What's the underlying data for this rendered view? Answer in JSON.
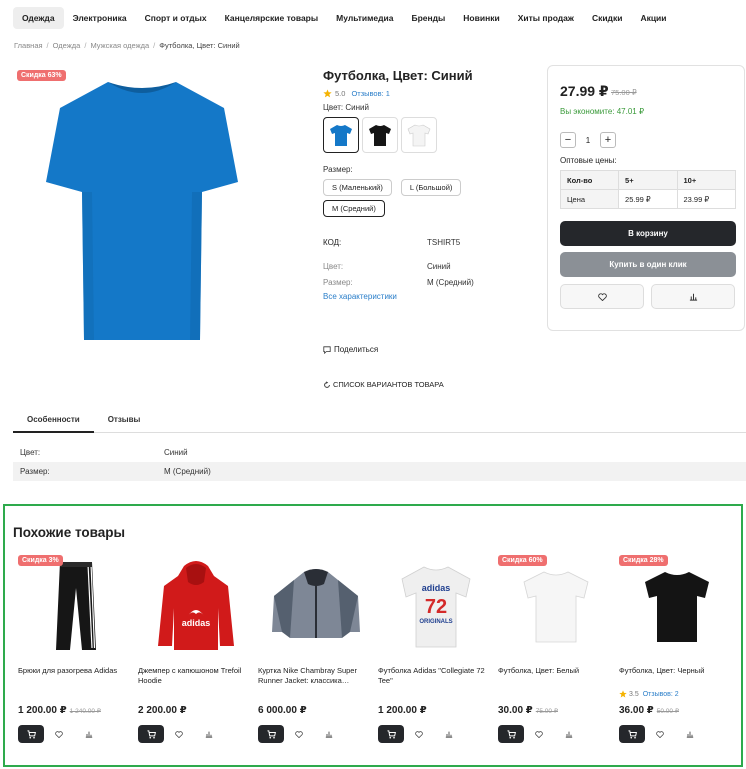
{
  "nav": {
    "items": [
      "Одежда",
      "Электроника",
      "Спорт и отдых",
      "Канцелярские товары",
      "Мультимедиа",
      "Бренды",
      "Новинки",
      "Хиты продаж",
      "Скидки",
      "Акции"
    ]
  },
  "breadcrumb": [
    "Главная",
    "Одежда",
    "Мужская одежда",
    "Футболка, Цвет: Синий"
  ],
  "product": {
    "badge": "Скидка 63%",
    "title": "Футболка, Цвет: Синий",
    "rating": "5.0",
    "reviews": "Отзывов: 1",
    "color_label": "Цвет: Синий",
    "size_label": "Размер:",
    "sizes": [
      "S (Маленький)",
      "L (Большой)",
      "M (Средний)"
    ],
    "selected_size_index": 2,
    "specs": {
      "code_label": "КОД:",
      "code_value": "TSHIRT5",
      "color_label": "Цвет:",
      "color_value": "Синий",
      "size_label": "Размер:",
      "size_value": "M (Средний)"
    },
    "all_specs_link": "Все характеристики",
    "share": "Поделиться",
    "variants": "СПИСОК ВАРИАНТОВ ТОВАРА",
    "colors": {
      "blue": "#1478c8",
      "black": "#151515",
      "white": "#f4f4f4"
    }
  },
  "buybox": {
    "price": "27.99 ₽",
    "old_price": "75.00 ₽",
    "savings": "Вы экономите: 47.01 ₽",
    "qty": "1",
    "minus": "−",
    "plus": "+",
    "wholesale_label": "Оптовые цены:",
    "wholesale": [
      [
        "Кол-во",
        "5+",
        "10+"
      ],
      [
        "Цена",
        "25.99 ₽",
        "23.99 ₽"
      ]
    ],
    "cart_button": "В корзину",
    "one_click_button": "Купить в один клик"
  },
  "tabs": [
    "Особенности",
    "Отзывы"
  ],
  "features": [
    [
      "Цвет:",
      "Синий"
    ],
    [
      "Размер:",
      "M (Средний)"
    ]
  ],
  "similar": {
    "title": "Похожие товары",
    "items": [
      {
        "name": "Брюки для разогрева Adidas",
        "price": "1 200.00 ₽",
        "old": "1 240.00 ₽",
        "badge": "Скидка 3%",
        "rating": "",
        "reviews": ""
      },
      {
        "name": "Джемпер с капюшоном Trefoil Hoodie",
        "price": "2 200.00 ₽",
        "old": "",
        "badge": "",
        "rating": "",
        "reviews": ""
      },
      {
        "name": "Куртка Nike Chambray Super Runner Jacket: классика…",
        "price": "6 000.00 ₽",
        "old": "",
        "badge": "",
        "rating": "",
        "reviews": ""
      },
      {
        "name": "Футболка Adidas \"Collegiate 72 Tee\"",
        "price": "1 200.00 ₽",
        "old": "",
        "badge": "",
        "rating": "",
        "reviews": ""
      },
      {
        "name": "Футболка, Цвет: Белый",
        "price": "30.00 ₽",
        "old": "75.00 ₽",
        "badge": "Скидка 60%",
        "rating": "",
        "reviews": ""
      },
      {
        "name": "Футболка, Цвет: Черный",
        "price": "36.00 ₽",
        "old": "50.00 ₽",
        "badge": "Скидка 28%",
        "rating": "3.5",
        "reviews": "Отзывов: 2"
      }
    ],
    "adidas_word": "adidas",
    "originals_word": "ORIGINALS",
    "tee_number": "72"
  }
}
